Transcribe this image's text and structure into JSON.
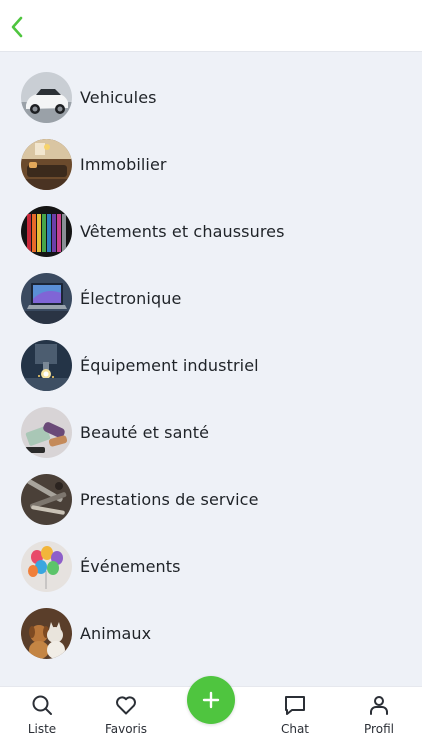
{
  "header": {
    "back_icon": "chevron-left-icon",
    "accent": "#4fc53f"
  },
  "categories": [
    {
      "label": "Vehicules",
      "icon": "car-thumbnail"
    },
    {
      "label": "Immobilier",
      "icon": "interior-thumbnail"
    },
    {
      "label": "Vêtements et chaussures",
      "icon": "clothes-thumbnail"
    },
    {
      "label": "Électronique",
      "icon": "laptop-thumbnail"
    },
    {
      "label": "Équipement industriel",
      "icon": "industrial-thumbnail"
    },
    {
      "label": "Beauté et santé",
      "icon": "cosmetics-thumbnail"
    },
    {
      "label": "Prestations de service",
      "icon": "tools-thumbnail"
    },
    {
      "label": "Événements",
      "icon": "balloons-thumbnail"
    },
    {
      "label": "Animaux",
      "icon": "pets-thumbnail"
    }
  ],
  "tabbar": {
    "tabs": [
      {
        "label": "Liste",
        "icon": "search-icon"
      },
      {
        "label": "Favoris",
        "icon": "heart-icon"
      },
      {
        "label": "Chat",
        "icon": "chat-icon"
      },
      {
        "label": "Profil",
        "icon": "user-icon"
      }
    ],
    "fab_icon": "plus-icon",
    "fab_color": "#4fc53f"
  }
}
